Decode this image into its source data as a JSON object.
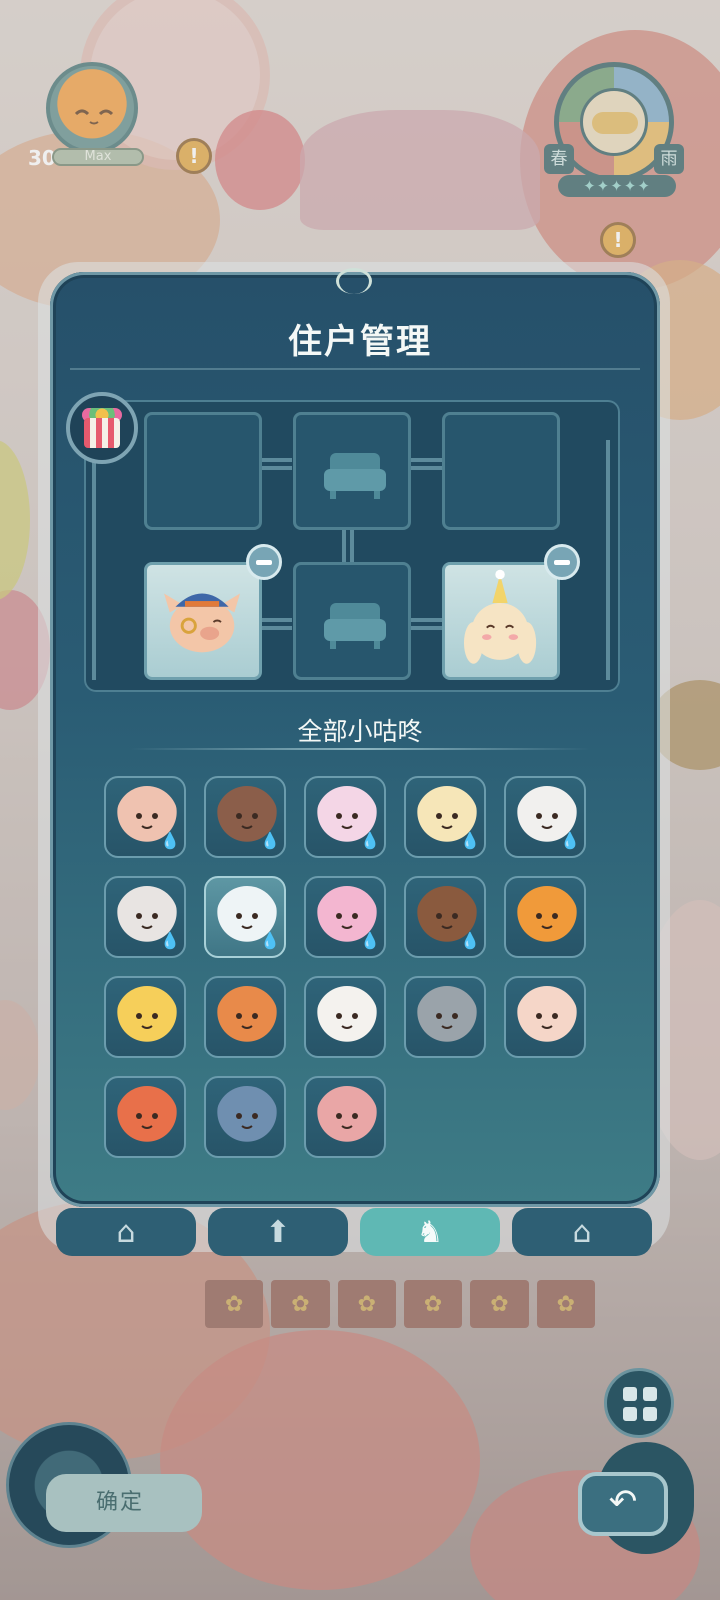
{
  "hud": {
    "level": "30",
    "xp_label": "Max",
    "season_left": "春",
    "season_right": "雨",
    "stars": "✦✦✦✦✦"
  },
  "modal": {
    "title": "住户管理",
    "section_title": "全部小咕咚"
  },
  "rooms": [
    {
      "state": "empty"
    },
    {
      "state": "sofa"
    },
    {
      "state": "empty"
    },
    {
      "state": "occupied",
      "resident": "pig-detective"
    },
    {
      "state": "sofa"
    },
    {
      "state": "occupied",
      "resident": "bunny-party-hat"
    }
  ],
  "characters": [
    {
      "name": "lynx",
      "color": "#efc2b0",
      "sleepy": true
    },
    {
      "name": "cow",
      "color": "#8b5e4a",
      "sleepy": true
    },
    {
      "name": "unicorn",
      "color": "#f4d6e6",
      "sleepy": true
    },
    {
      "name": "chick",
      "color": "#f6e6b8",
      "sleepy": true
    },
    {
      "name": "sheep",
      "color": "#f1f0ee",
      "sleepy": true
    },
    {
      "name": "white-hair-doll",
      "color": "#e8e4e2",
      "sleepy": true
    },
    {
      "name": "ghost",
      "color": "#eef4f6",
      "sleepy": true,
      "selected": true
    },
    {
      "name": "pink-bunny",
      "color": "#f3b6d0",
      "sleepy": true
    },
    {
      "name": "brown-bunny",
      "color": "#8a5a3e",
      "sleepy": true
    },
    {
      "name": "fox",
      "color": "#f09a3a",
      "sleepy": false
    },
    {
      "name": "yellow-cat",
      "color": "#f6cf5a",
      "sleepy": false
    },
    {
      "name": "shiba",
      "color": "#e88a4a",
      "sleepy": false
    },
    {
      "name": "duck-cap",
      "color": "#f4f2ee",
      "sleepy": false
    },
    {
      "name": "husky",
      "color": "#9aa3aa",
      "sleepy": false
    },
    {
      "name": "bear-glasses",
      "color": "#f5d6c8",
      "sleepy": false
    },
    {
      "name": "red-fox",
      "color": "#e8704a",
      "sleepy": false
    },
    {
      "name": "blue-hair-frog",
      "color": "#6f8fb0",
      "sleepy": false
    },
    {
      "name": "pink-lizard",
      "color": "#e9a6a6",
      "sleepy": false
    }
  ],
  "tabs": [
    {
      "icon": "house-icon",
      "glyph": "⌂"
    },
    {
      "icon": "upgrade-arrow-icon",
      "glyph": "⬆"
    },
    {
      "icon": "resident-icon",
      "glyph": "♞",
      "active": true
    },
    {
      "icon": "house-wrench-icon",
      "glyph": "⌂"
    }
  ],
  "buttons": {
    "confirm": "确定",
    "back_glyph": "↶"
  },
  "colors": {
    "panel": "#26506a",
    "active_tab": "#5fb8b4"
  }
}
